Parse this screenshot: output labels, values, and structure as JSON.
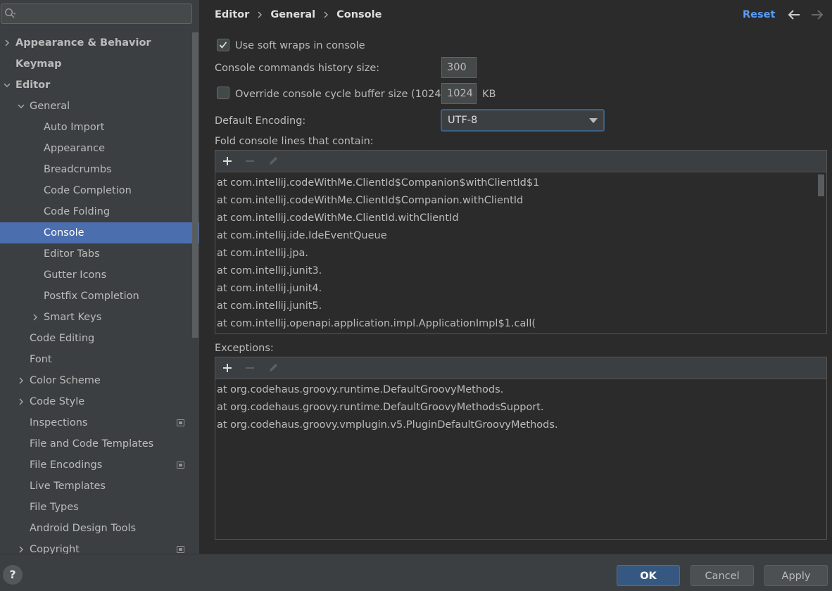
{
  "search": {
    "placeholder": ""
  },
  "sidebar": {
    "items": [
      {
        "label": "Appearance & Behavior",
        "bold": true,
        "chevron": "right"
      },
      {
        "label": "Keymap",
        "bold": true,
        "chevron": null
      },
      {
        "label": "Editor",
        "bold": true,
        "chevron": "down"
      },
      {
        "label": "General",
        "bold": false,
        "chevron": "down"
      },
      {
        "label": "Auto Import",
        "bold": false,
        "chevron": null
      },
      {
        "label": "Appearance",
        "bold": false,
        "chevron": null
      },
      {
        "label": "Breadcrumbs",
        "bold": false,
        "chevron": null
      },
      {
        "label": "Code Completion",
        "bold": false,
        "chevron": null
      },
      {
        "label": "Code Folding",
        "bold": false,
        "chevron": null
      },
      {
        "label": "Console",
        "bold": false,
        "chevron": null,
        "selected": true
      },
      {
        "label": "Editor Tabs",
        "bold": false,
        "chevron": null
      },
      {
        "label": "Gutter Icons",
        "bold": false,
        "chevron": null
      },
      {
        "label": "Postfix Completion",
        "bold": false,
        "chevron": null
      },
      {
        "label": "Smart Keys",
        "bold": false,
        "chevron": "right"
      },
      {
        "label": "Code Editing",
        "bold": false,
        "chevron": null
      },
      {
        "label": "Font",
        "bold": false,
        "chevron": null
      },
      {
        "label": "Color Scheme",
        "bold": false,
        "chevron": "right"
      },
      {
        "label": "Code Style",
        "bold": false,
        "chevron": "right"
      },
      {
        "label": "Inspections",
        "bold": false,
        "chevron": null,
        "project_icon": true
      },
      {
        "label": "File and Code Templates",
        "bold": false,
        "chevron": null
      },
      {
        "label": "File Encodings",
        "bold": false,
        "chevron": null,
        "project_icon": true
      },
      {
        "label": "Live Templates",
        "bold": false,
        "chevron": null
      },
      {
        "label": "File Types",
        "bold": false,
        "chevron": null
      },
      {
        "label": "Android Design Tools",
        "bold": false,
        "chevron": null
      },
      {
        "label": "Copyright",
        "bold": false,
        "chevron": "right",
        "project_icon": true
      }
    ]
  },
  "breadcrumb": {
    "items": [
      "Editor",
      "General",
      "Console"
    ]
  },
  "header": {
    "reset_label": "Reset"
  },
  "form": {
    "soft_wraps": {
      "label": "Use soft wraps in console",
      "checked": true
    },
    "history": {
      "label": "Console commands history size:",
      "value": "300"
    },
    "cycle_buffer": {
      "label": "Override console cycle buffer size (1024 KB)",
      "checked": false,
      "value": "1024",
      "unit": "KB"
    },
    "encoding": {
      "label": "Default Encoding:",
      "value": "UTF-8"
    }
  },
  "fold": {
    "label": "Fold console lines that contain:",
    "rows": [
      "at com.intellij.codeWithMe.ClientId$Companion$withClientId$1",
      "at com.intellij.codeWithMe.ClientId$Companion.withClientId",
      "at com.intellij.codeWithMe.ClientId.withClientId",
      "at com.intellij.ide.IdeEventQueue",
      "at com.intellij.jpa.",
      "at com.intellij.junit3.",
      "at com.intellij.junit4.",
      "at com.intellij.junit5.",
      "at com.intellij.openapi.application.impl.ApplicationImpl$1.call("
    ]
  },
  "exceptions": {
    "label": "Exceptions:",
    "rows": [
      "at org.codehaus.groovy.runtime.DefaultGroovyMethods.",
      "at org.codehaus.groovy.runtime.DefaultGroovyMethodsSupport.",
      "at org.codehaus.groovy.vmplugin.v5.PluginDefaultGroovyMethods."
    ]
  },
  "footer": {
    "help_label": "?",
    "ok_label": "OK",
    "cancel_label": "Cancel",
    "apply_label": "Apply"
  },
  "colors": {
    "accent": "#4b6eaf",
    "link": "#589df6",
    "default_button": "#365880"
  }
}
